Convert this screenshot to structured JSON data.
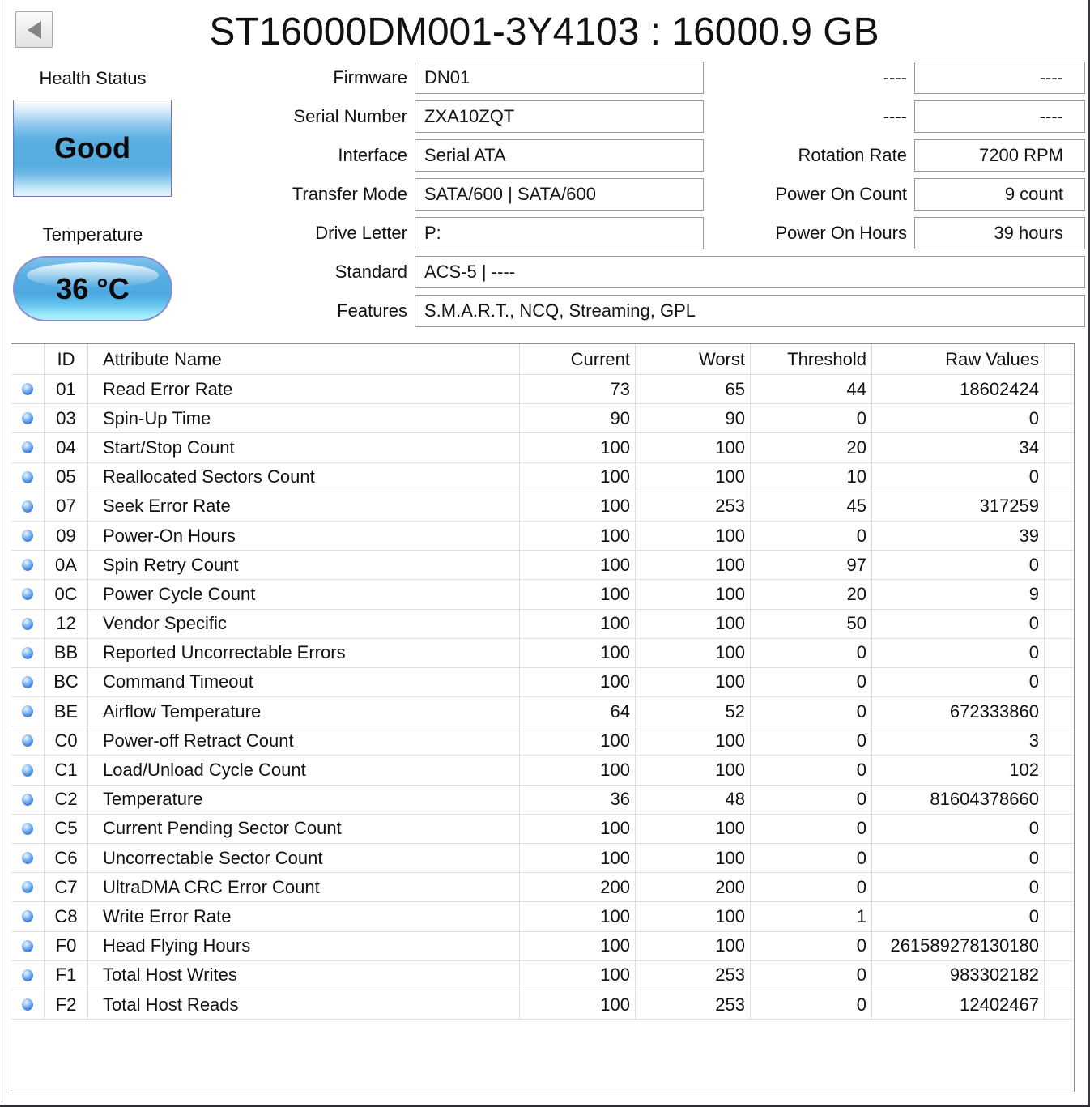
{
  "window": {
    "title": "ST16000DM001-3Y4103 : 16000.9 GB"
  },
  "health": {
    "label": "Health Status",
    "status": "Good"
  },
  "temperature": {
    "label": "Temperature",
    "value": "36 °C"
  },
  "drive_info": {
    "left": [
      {
        "label": "Firmware",
        "value": "DN01",
        "wide": false
      },
      {
        "label": "Serial Number",
        "value": "ZXA10ZQT",
        "wide": false
      },
      {
        "label": "Interface",
        "value": "Serial ATA",
        "wide": false
      },
      {
        "label": "Transfer Mode",
        "value": "SATA/600 | SATA/600",
        "wide": false
      },
      {
        "label": "Drive Letter",
        "value": "P:",
        "wide": false
      },
      {
        "label": "Standard",
        "value": "ACS-5 | ----",
        "wide": true
      },
      {
        "label": "Features",
        "value": "S.M.A.R.T., NCQ, Streaming, GPL",
        "wide": true
      }
    ],
    "right": [
      {
        "label": "----",
        "value": "----"
      },
      {
        "label": "----",
        "value": "----"
      },
      {
        "label": "Rotation Rate",
        "value": "7200 RPM"
      },
      {
        "label": "Power On Count",
        "value": "9 count"
      },
      {
        "label": "Power On Hours",
        "value": "39 hours"
      }
    ]
  },
  "smart_table": {
    "headers": {
      "id": "ID",
      "name": "Attribute Name",
      "current": "Current",
      "worst": "Worst",
      "threshold": "Threshold",
      "raw": "Raw Values"
    },
    "rows": [
      {
        "id": "01",
        "name": "Read Error Rate",
        "current": "73",
        "worst": "65",
        "threshold": "44",
        "raw": "18602424"
      },
      {
        "id": "03",
        "name": "Spin-Up Time",
        "current": "90",
        "worst": "90",
        "threshold": "0",
        "raw": "0"
      },
      {
        "id": "04",
        "name": "Start/Stop Count",
        "current": "100",
        "worst": "100",
        "threshold": "20",
        "raw": "34"
      },
      {
        "id": "05",
        "name": "Reallocated Sectors Count",
        "current": "100",
        "worst": "100",
        "threshold": "10",
        "raw": "0"
      },
      {
        "id": "07",
        "name": "Seek Error Rate",
        "current": "100",
        "worst": "253",
        "threshold": "45",
        "raw": "317259"
      },
      {
        "id": "09",
        "name": "Power-On Hours",
        "current": "100",
        "worst": "100",
        "threshold": "0",
        "raw": "39"
      },
      {
        "id": "0A",
        "name": "Spin Retry Count",
        "current": "100",
        "worst": "100",
        "threshold": "97",
        "raw": "0"
      },
      {
        "id": "0C",
        "name": "Power Cycle Count",
        "current": "100",
        "worst": "100",
        "threshold": "20",
        "raw": "9"
      },
      {
        "id": "12",
        "name": "Vendor Specific",
        "current": "100",
        "worst": "100",
        "threshold": "50",
        "raw": "0"
      },
      {
        "id": "BB",
        "name": "Reported Uncorrectable Errors",
        "current": "100",
        "worst": "100",
        "threshold": "0",
        "raw": "0"
      },
      {
        "id": "BC",
        "name": "Command Timeout",
        "current": "100",
        "worst": "100",
        "threshold": "0",
        "raw": "0"
      },
      {
        "id": "BE",
        "name": "Airflow Temperature",
        "current": "64",
        "worst": "52",
        "threshold": "0",
        "raw": "672333860"
      },
      {
        "id": "C0",
        "name": "Power-off Retract Count",
        "current": "100",
        "worst": "100",
        "threshold": "0",
        "raw": "3"
      },
      {
        "id": "C1",
        "name": "Load/Unload Cycle Count",
        "current": "100",
        "worst": "100",
        "threshold": "0",
        "raw": "102"
      },
      {
        "id": "C2",
        "name": "Temperature",
        "current": "36",
        "worst": "48",
        "threshold": "0",
        "raw": "81604378660"
      },
      {
        "id": "C5",
        "name": "Current Pending Sector Count",
        "current": "100",
        "worst": "100",
        "threshold": "0",
        "raw": "0"
      },
      {
        "id": "C6",
        "name": "Uncorrectable Sector Count",
        "current": "100",
        "worst": "100",
        "threshold": "0",
        "raw": "0"
      },
      {
        "id": "C7",
        "name": "UltraDMA CRC Error Count",
        "current": "200",
        "worst": "200",
        "threshold": "0",
        "raw": "0"
      },
      {
        "id": "C8",
        "name": "Write Error Rate",
        "current": "100",
        "worst": "100",
        "threshold": "1",
        "raw": "0"
      },
      {
        "id": "F0",
        "name": "Head Flying Hours",
        "current": "100",
        "worst": "100",
        "threshold": "0",
        "raw": "261589278130180"
      },
      {
        "id": "F1",
        "name": "Total Host Writes",
        "current": "100",
        "worst": "253",
        "threshold": "0",
        "raw": "983302182"
      },
      {
        "id": "F2",
        "name": "Total Host Reads",
        "current": "100",
        "worst": "253",
        "threshold": "0",
        "raw": "12402467"
      }
    ]
  }
}
